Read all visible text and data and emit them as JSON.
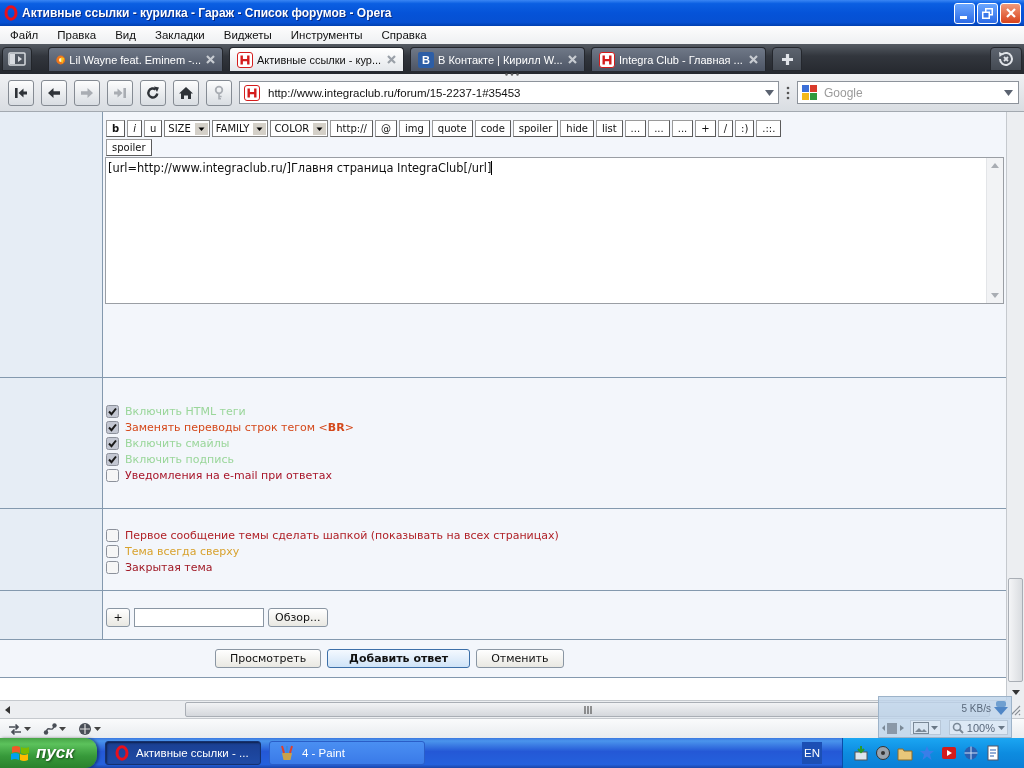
{
  "window": {
    "title": "Активные ссылки - курилка - Гараж - Список форумов - Opera"
  },
  "menu": [
    "Файл",
    "Правка",
    "Вид",
    "Закладки",
    "Виджеты",
    "Инструменты",
    "Справка"
  ],
  "tabs": [
    {
      "label": "Lil Wayne feat. Eminem -...",
      "kind": "circle",
      "selected": false
    },
    {
      "label": "Активные ссылки - кур...",
      "kind": "h",
      "selected": true
    },
    {
      "label": "В Контакте | Кирилл W...",
      "kind": "letter",
      "logo_letter": "В",
      "selected": false
    },
    {
      "label": "Integra Club - Главная ...",
      "kind": "h",
      "selected": false
    }
  ],
  "navigation": {
    "buttons": [
      {
        "kind": "first",
        "disabled": false
      },
      {
        "kind": "back",
        "disabled": false
      },
      {
        "kind": "forward",
        "disabled": true
      },
      {
        "kind": "last",
        "disabled": true
      },
      {
        "kind": "reload",
        "disabled": false
      },
      {
        "kind": "home",
        "disabled": false
      },
      {
        "kind": "key",
        "disabled": true
      }
    ],
    "address": "http://www.integraclub.ru/forum/15-2237-1#35453",
    "search": {
      "placeholder": "Google"
    }
  },
  "editor": {
    "toolbar_rows": [
      {
        "buttons": [
          {
            "label": "b",
            "kind": "bold"
          },
          {
            "label": "i",
            "kind": "italic"
          },
          {
            "label": "u",
            "kind": "plain"
          },
          {
            "label": "SIZE",
            "kind": "select"
          },
          {
            "label": "FAMILY",
            "kind": "select"
          },
          {
            "label": "COLOR",
            "kind": "select"
          },
          {
            "label": "http://",
            "kind": "plain"
          },
          {
            "label": "@",
            "kind": "plain"
          },
          {
            "label": "img",
            "kind": "plain"
          },
          {
            "label": "quote",
            "kind": "plain"
          },
          {
            "label": "code",
            "kind": "plain"
          },
          {
            "label": "spoiler",
            "kind": "plain"
          },
          {
            "label": "hide",
            "kind": "plain"
          },
          {
            "label": "list",
            "kind": "plain"
          },
          {
            "label": "...",
            "kind": "plain"
          },
          {
            "label": "...",
            "kind": "plain"
          },
          {
            "label": "...",
            "kind": "plain"
          },
          {
            "label": "+",
            "kind": "plain"
          },
          {
            "label": "/",
            "kind": "plain"
          },
          {
            "label": ":)",
            "kind": "plain"
          },
          {
            "label": ".::.",
            "kind": "plain"
          }
        ]
      },
      {
        "buttons": [
          {
            "label": "spoiler",
            "kind": "plain"
          }
        ]
      }
    ],
    "message": "[url=http://www.integraclub.ru/]Главня страница IntegraClub[/url]"
  },
  "post_options": [
    {
      "label": "Включить HTML теги",
      "checked": true,
      "color": "#9ad69a"
    },
    {
      "label": "Заменять переводы строк тегом <**BR**>",
      "checked": true,
      "color": "#d4481a"
    },
    {
      "label": "Включить смайлы",
      "checked": true,
      "color": "#9ad69a"
    },
    {
      "label": "Включить подпись",
      "checked": true,
      "color": "#9ad69a"
    },
    {
      "label": "Уведомления на e-mail при ответах",
      "checked": false,
      "color": "#a8162a"
    }
  ],
  "topic_options": [
    {
      "label": "Первое сообщение темы сделать шапкой (показывать на всех страницах)",
      "checked": false,
      "color": "#b02228"
    },
    {
      "label": "Тема всегда сверху",
      "checked": false,
      "color": "#d8a22e"
    },
    {
      "label": "Закрытая тема",
      "checked": false,
      "color": "#a01a26"
    }
  ],
  "attachment": {
    "add_button": "+",
    "browse_button": "Обзор..."
  },
  "actions": [
    {
      "label": "Просмотреть",
      "kind": "normal"
    },
    {
      "label": "Добавить ответ",
      "kind": "default"
    },
    {
      "label": "Отменить",
      "kind": "normal"
    }
  ],
  "status_panel": {
    "speed": "5 KB/s",
    "zoom": "100%"
  },
  "taskbar": {
    "start": "пуск",
    "tasks": [
      {
        "label": "Активные ссылки - ...",
        "kind": "ring",
        "selected": true
      },
      {
        "label": "4 - Paint",
        "kind": "brushes",
        "selected": false
      }
    ],
    "language": "EN"
  }
}
